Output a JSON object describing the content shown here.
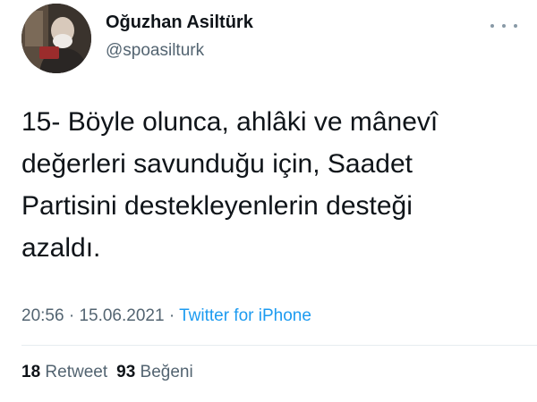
{
  "author": {
    "name": "Oğuzhan Asiltürk",
    "handle": "@spoasilturk",
    "avatar_icon": "profile-photo"
  },
  "more_icon": "more-horizontal-icon",
  "tweet": {
    "text": "15- Böyle olunca, ahlâki ve mânevî\ndeğerleri savunduğu için, Saadet\nPartisini destekleyenlerin desteği\nazaldı."
  },
  "meta": {
    "time": "20:56",
    "separator": "·",
    "date": "15.06.2021",
    "source": "Twitter for iPhone"
  },
  "stats": {
    "retweet_count": "18",
    "retweet_label": "Retweet",
    "like_count": "93",
    "like_label": "Beğeni"
  },
  "colors": {
    "link": "#1d9bf0",
    "secondary": "#536471",
    "primary": "#0f1419"
  }
}
